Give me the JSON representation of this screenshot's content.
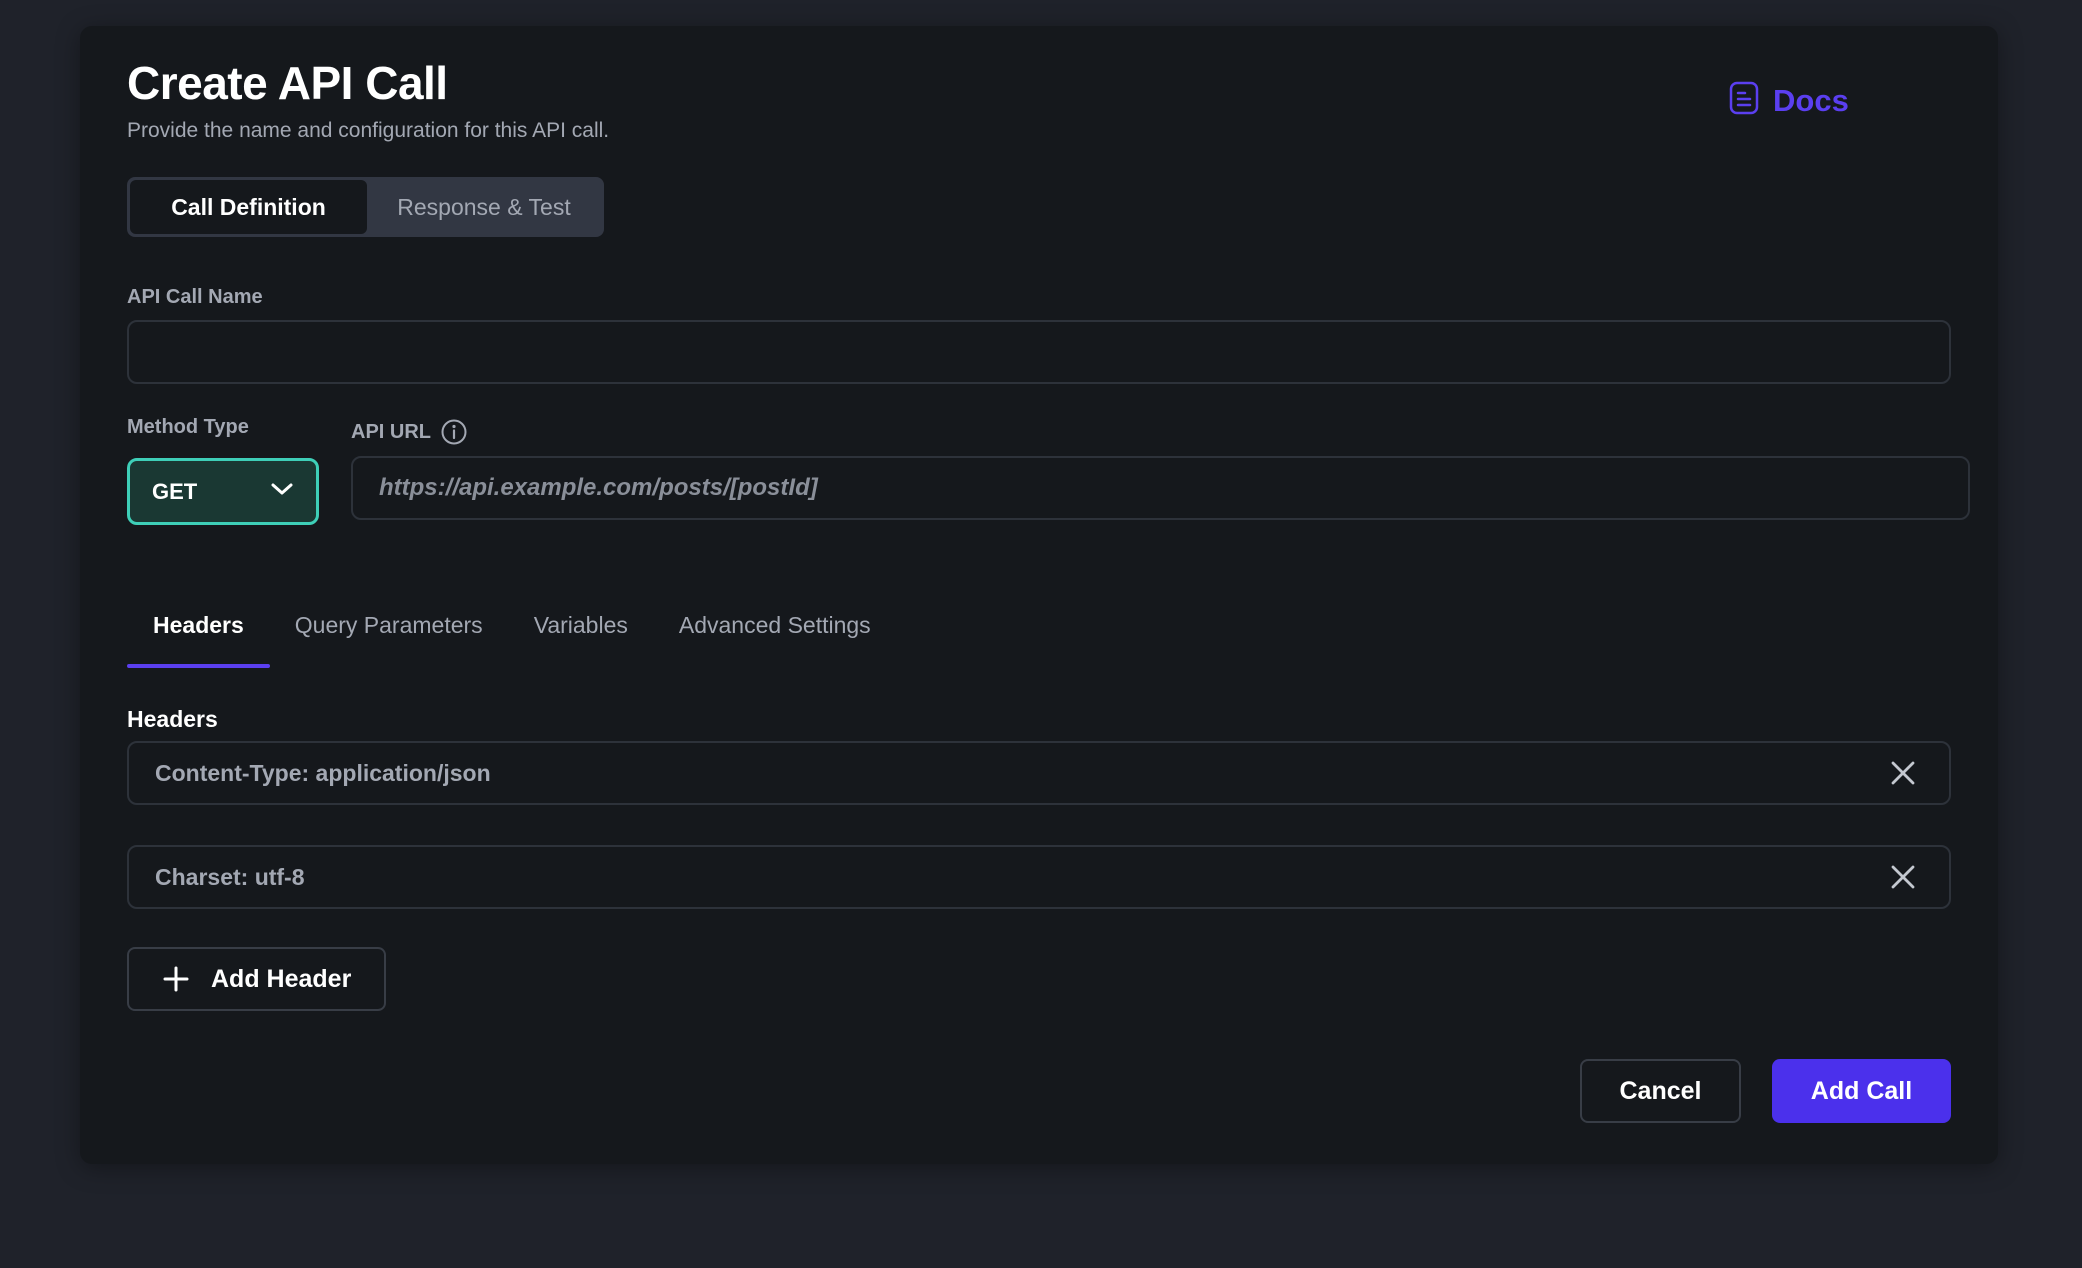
{
  "dialog": {
    "title": "Create API Call",
    "subtitle": "Provide the name and configuration for this API call.",
    "docs_label": "Docs"
  },
  "segments": [
    {
      "label": "Call Definition",
      "active": true
    },
    {
      "label": "Response & Test",
      "active": false
    }
  ],
  "form": {
    "name_label": "API Call Name",
    "name_value": "",
    "method_label": "Method Type",
    "method_value": "GET",
    "url_label": "API URL",
    "url_placeholder": "https://api.example.com/posts/[postId]"
  },
  "tabs": [
    {
      "label": "Headers",
      "active": true
    },
    {
      "label": "Query Parameters",
      "active": false
    },
    {
      "label": "Variables",
      "active": false
    },
    {
      "label": "Advanced Settings",
      "active": false
    }
  ],
  "headers_section": {
    "title": "Headers",
    "items": [
      {
        "text": "Content-Type: application/json"
      },
      {
        "text": "Charset: utf-8"
      }
    ],
    "add_label": "Add Header"
  },
  "footer": {
    "cancel_label": "Cancel",
    "submit_label": "Add Call"
  },
  "colors": {
    "accent": "#4b30ec",
    "method_border": "#3ecfb8",
    "background": "#15181c"
  },
  "icons": {
    "docs": "document-icon",
    "method": "chevron-down-icon",
    "url_info": "info-icon",
    "remove": "close-icon",
    "add": "plus-icon"
  }
}
